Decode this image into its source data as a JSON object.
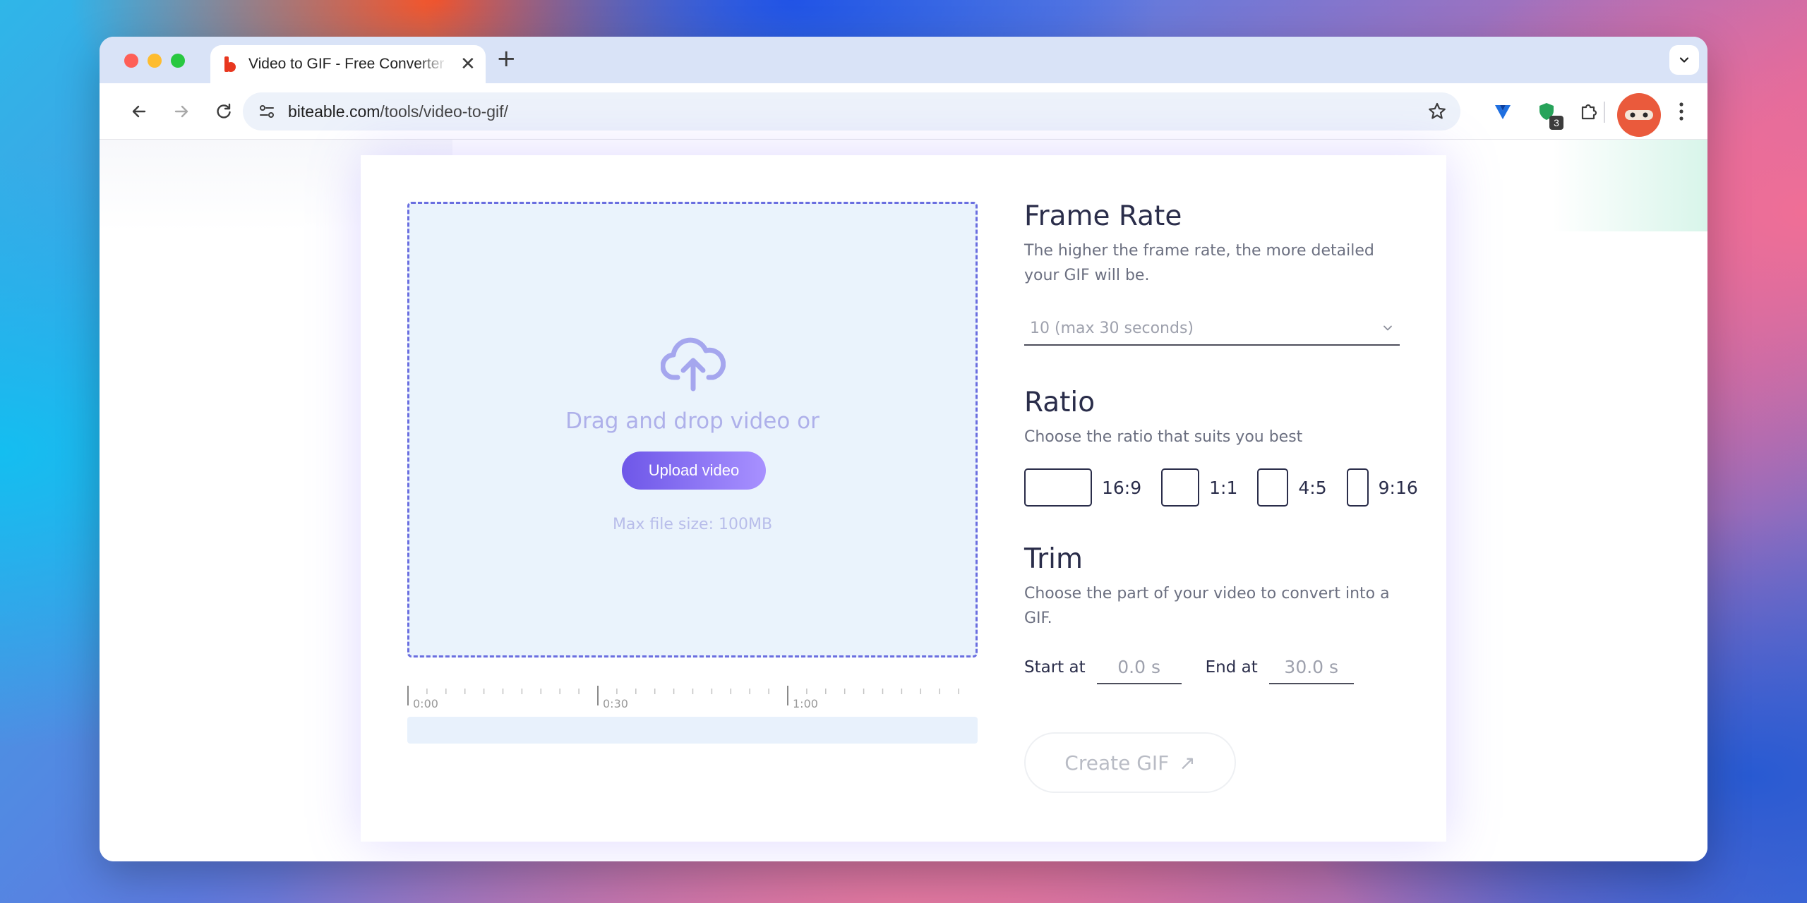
{
  "browser": {
    "tab_title": "Video to GIF - Free Converter",
    "tab_close": "✕",
    "new_tab": "+",
    "url_host": "biteable.com",
    "url_path": "/tools/video-to-gif/",
    "extension_badge": "3"
  },
  "upload": {
    "drag_text": "Drag and drop video or",
    "button_label": "Upload video",
    "max_size": "Max file size: 100MB"
  },
  "timeline": {
    "labels": [
      "0:00",
      "0:30",
      "1:00"
    ]
  },
  "frame_rate": {
    "heading": "Frame Rate",
    "description": "The higher the frame rate, the more detailed your GIF will be.",
    "selected": "10 (max 30 seconds)"
  },
  "ratio": {
    "heading": "Ratio",
    "description": "Choose the ratio that suits you best",
    "options": [
      "16:9",
      "1:1",
      "4:5",
      "9:16"
    ]
  },
  "trim": {
    "heading": "Trim",
    "description": "Choose the part of your video to convert into a GIF.",
    "start_label": "Start at",
    "start_value": "0.0 s",
    "end_label": "End at",
    "end_value": "30.0 s"
  },
  "create_button": {
    "label": "Create GIF",
    "arrow": "↗"
  },
  "colors": {
    "accent": "#6e57e8",
    "dropzone_border": "#6a6ee0",
    "dropzone_bg": "#eaf3fc",
    "heading": "#2a2d4a"
  }
}
